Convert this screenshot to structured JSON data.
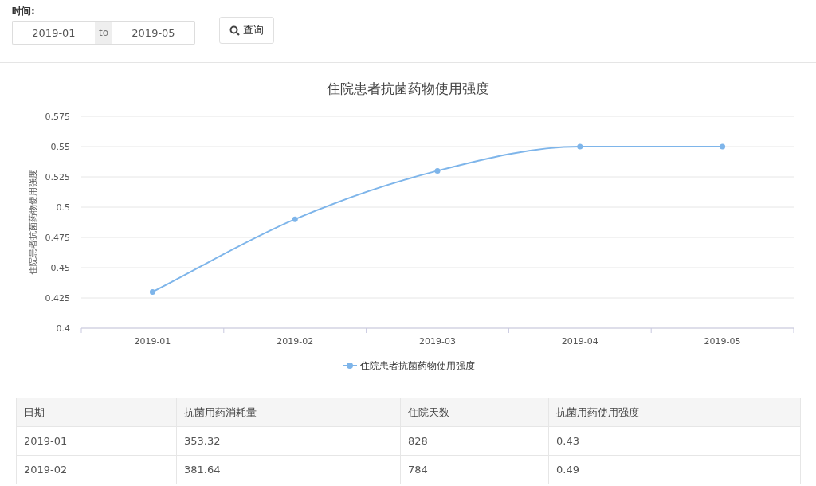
{
  "filter": {
    "label": "时间:",
    "start": "2019-01",
    "separator": "to",
    "end": "2019-05",
    "query_button": "查询"
  },
  "chart": {
    "chart_data": {
      "type": "line",
      "title": "住院患者抗菌药物使用强度",
      "ylabel": "住院患者抗菌药物使用强度",
      "categories": [
        "2019-01",
        "2019-02",
        "2019-03",
        "2019-04",
        "2019-05"
      ],
      "grid": true,
      "series": [
        {
          "name": "住院患者抗菌药物使用强度",
          "color": "#7eb5ea",
          "marker": true,
          "values": [
            0.43,
            0.49,
            0.53,
            0.55,
            0.55
          ]
        }
      ],
      "ylim": [
        0.4,
        0.575
      ],
      "yticks": [
        0.4,
        0.425,
        0.45,
        0.475,
        0.5,
        0.525,
        0.55,
        0.575
      ]
    }
  },
  "table": {
    "columns": [
      "日期",
      "抗菌用药消耗量",
      "住院天数",
      "抗菌用药使用强度"
    ],
    "rows": [
      [
        "2019-01",
        "353.32",
        "828",
        "0.43"
      ],
      [
        "2019-02",
        "381.64",
        "784",
        "0.49"
      ]
    ]
  }
}
